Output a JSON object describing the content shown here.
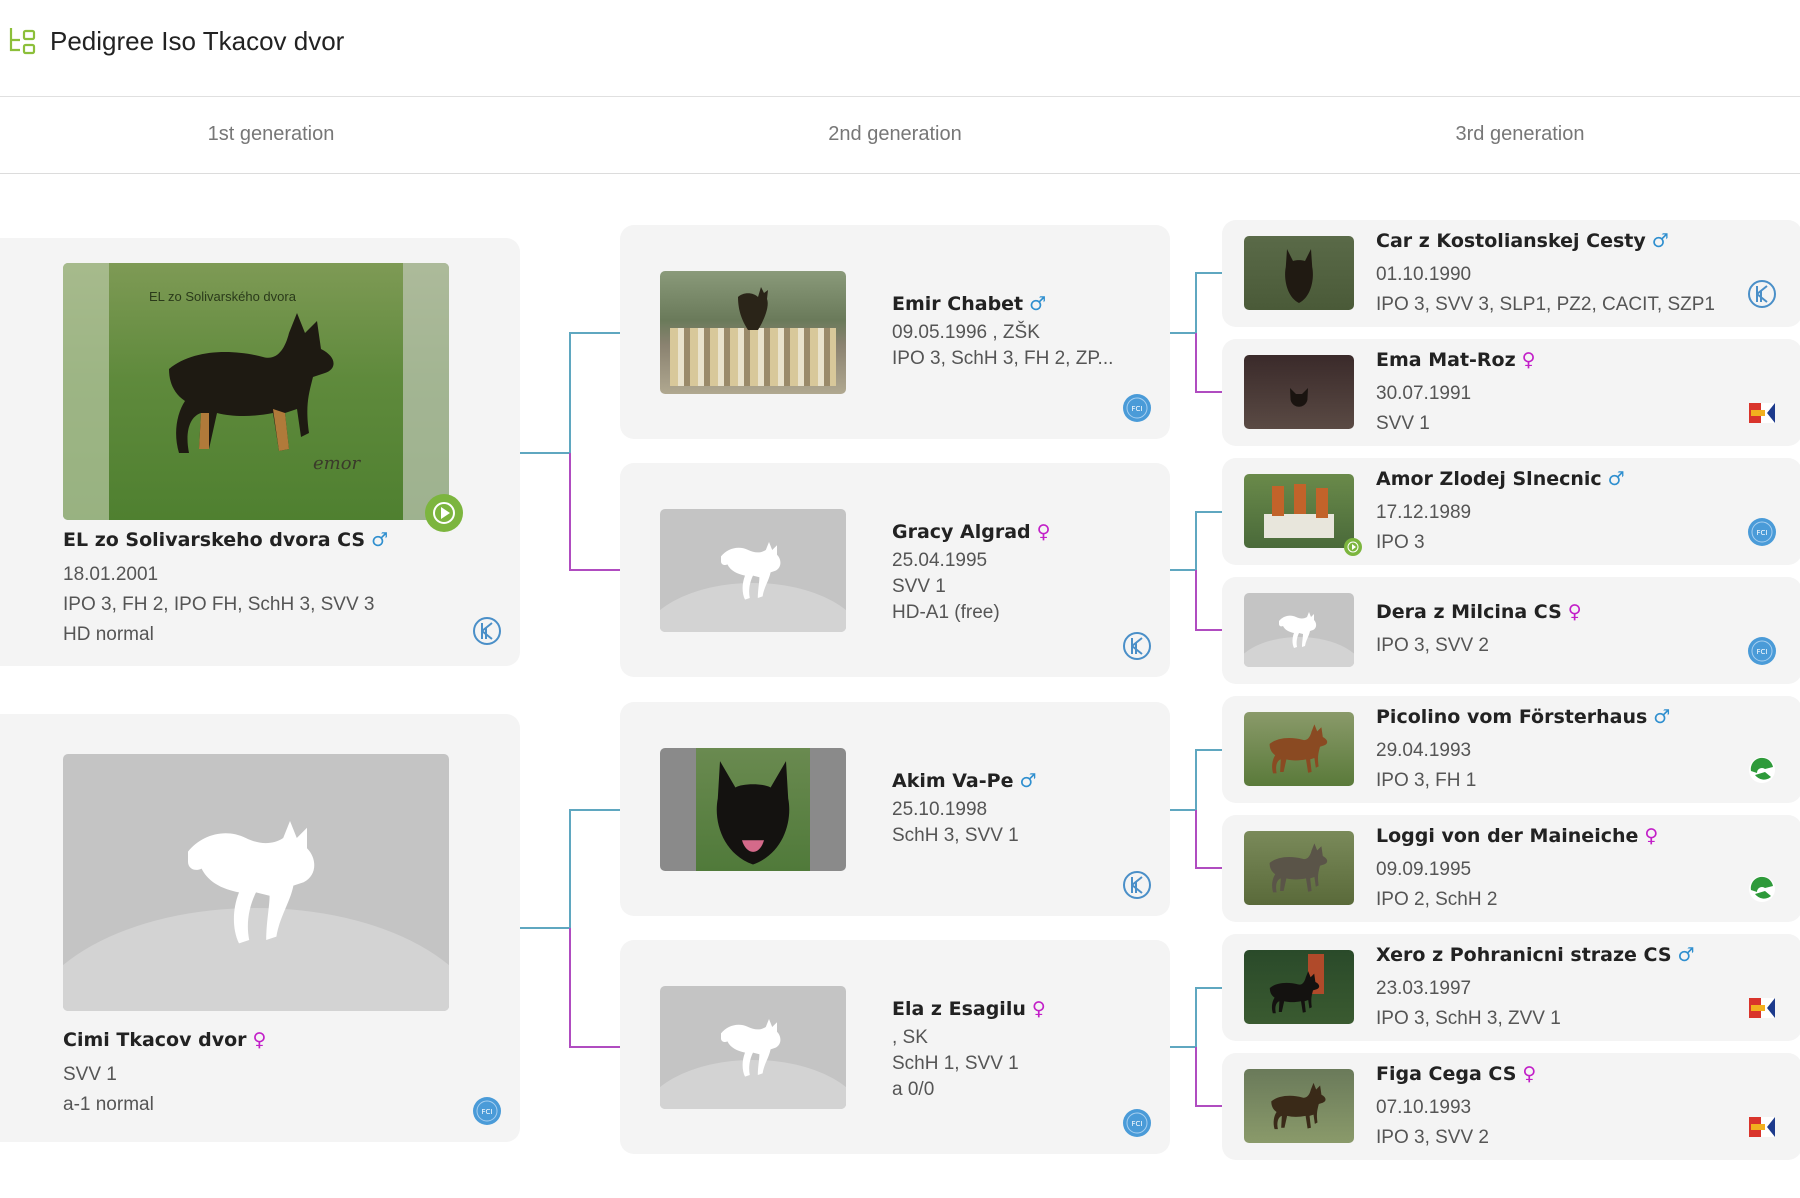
{
  "header": {
    "title": "Pedigree Iso Tkacov dvor",
    "icon": "pedigree-tree-icon"
  },
  "generations": [
    "1st generation",
    "2nd generation",
    "3rd generation"
  ],
  "colors": {
    "male": "#2f8fcf",
    "female": "#c21fc8",
    "accent": "#7cb53e",
    "card": "#f4f4f4"
  },
  "gen1": [
    {
      "name": "EL zo Solivarskeho dvora CS",
      "sex": "♂",
      "lines": [
        "18.01.2001",
        "IPO 3, FH 2, IPO FH, SchH 3, SVV 3",
        "HD normal"
      ],
      "photo_caption": "EL zo Solivarského dvora",
      "photo_watermark": "emor",
      "badge": "kennel-logo-icon",
      "video": true
    },
    {
      "name": "Cimi Tkacov dvor",
      "sex": "♀",
      "lines": [
        "SVV 1",
        "a-1 normal"
      ],
      "badge": "fci-logo-icon"
    }
  ],
  "gen2": [
    {
      "name": "Emir Chabet",
      "sex": "♂",
      "lines": [
        "09.05.1996 , ZŠK",
        "IPO 3, SchH 3, FH 2, ZP..."
      ],
      "badge": "fci-logo-icon"
    },
    {
      "name": "Gracy Algrad",
      "sex": "♀",
      "lines": [
        "25.04.1995",
        "SVV 1",
        "HD-A1 (free)"
      ],
      "badge": "kennel-logo-icon"
    },
    {
      "name": "Akim Va-Pe",
      "sex": "♂",
      "lines": [
        "25.10.1998",
        "SchH 3, SVV 1"
      ],
      "badge": "kennel-logo-icon"
    },
    {
      "name": "Ela z Esagilu",
      "sex": "♀",
      "lines": [
        ", SK",
        "SchH 1, SVV 1",
        "a 0/0"
      ],
      "badge": "fci-logo-icon"
    }
  ],
  "gen3": [
    {
      "name": "Car z Kostolianskej Cesty",
      "sex": "♂",
      "lines": [
        "01.10.1990",
        "IPO 3, SVV 3, SLP1, PZ2, CACIT, SZP1"
      ],
      "badge": "kennel-logo-icon"
    },
    {
      "name": "Ema Mat-Roz",
      "sex": "♀",
      "lines": [
        "30.07.1991",
        "SVV 1"
      ],
      "badge": "cmkp-flag-icon"
    },
    {
      "name": "Amor Zlodej Slnecnic",
      "sex": "♂",
      "lines": [
        "17.12.1989",
        "IPO 3"
      ],
      "badge": "fci-logo-icon",
      "video": true
    },
    {
      "name": "Dera z Milcina CS",
      "sex": "♀",
      "lines": [
        "IPO 3, SVV 2"
      ],
      "badge": "fci-logo-icon"
    },
    {
      "name": "Picolino vom Försterhaus",
      "sex": "♂",
      "lines": [
        "29.04.1993",
        "IPO 3, FH 1"
      ],
      "badge": "vdh-logo-icon"
    },
    {
      "name": "Loggi von der Maineiche",
      "sex": "♀",
      "lines": [
        "09.09.1995",
        "IPO 2, SchH 2"
      ],
      "badge": "vdh-logo-icon"
    },
    {
      "name": "Xero z Pohranicni straze CS",
      "sex": "♂",
      "lines": [
        "23.03.1997",
        "IPO 3, SchH 3, ZVV 1"
      ],
      "badge": "cmkp-flag-icon"
    },
    {
      "name": "Figa Cega CS",
      "sex": "♀",
      "lines": [
        "07.10.1993",
        "IPO 3, SVV 2"
      ],
      "badge": "cmkp-flag-icon"
    }
  ]
}
